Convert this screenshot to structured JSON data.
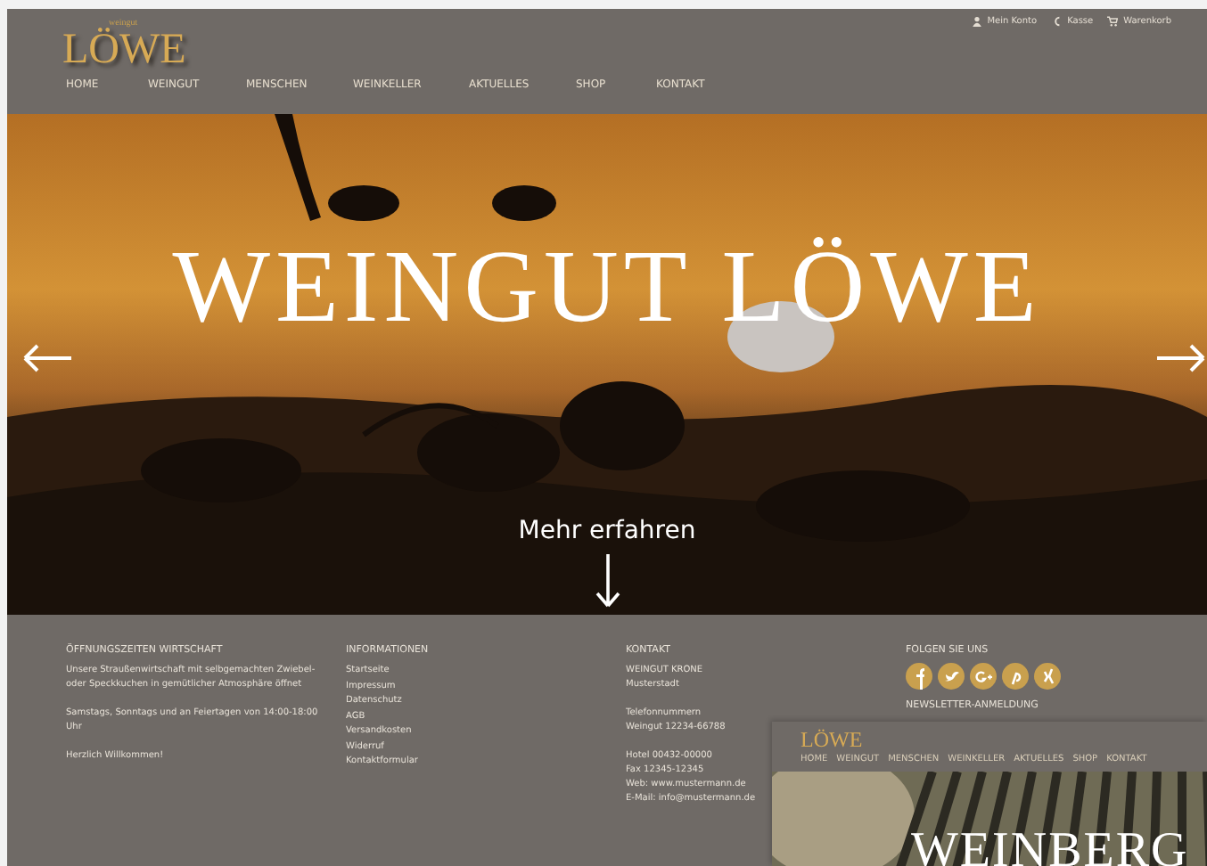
{
  "account_links": [
    {
      "kind": "account",
      "label": "Mein Konto"
    },
    {
      "kind": "checkout",
      "label": "Kasse"
    },
    {
      "kind": "basket",
      "label": "Warenkorb"
    }
  ],
  "logo": {
    "small": "weingut",
    "name": "LÖWE"
  },
  "nav": [
    "HOME",
    "WEINGUT",
    "MENSCHEN",
    "WEINKELLER",
    "AKTUELLES",
    "SHOP",
    "KONTAKT"
  ],
  "hero": {
    "title": "WEINGUT LÖWE",
    "button": "Mehr erfahren"
  },
  "footer": [
    {
      "heading": "ÖFFNUNGSZEITEN WIRTSCHAFT",
      "kind": "text",
      "lines": [
        "Unsere Straußenwirtschaft mit selbgemachten Zwiebel- oder Speckkuchen in gemütlicher Atmosphäre öffnet",
        "Samstags, Sonntags und an Feiertagen von 14:00-18:00 Uhr",
        "Herzlich Willkommen!"
      ]
    },
    {
      "heading": "INFORMATIONEN",
      "kind": "links",
      "lines": [
        "Startseite",
        "Impressum",
        "Datenschutz",
        "AGB",
        "Versandkosten",
        "Widerruf",
        "Kontaktformular"
      ]
    },
    {
      "heading": "KONTAKT",
      "kind": "text",
      "lines": [
        "WEINGUT KRONE\nMusterstadt",
        "Telefonnummern\nWeingut 12234-66788",
        "Hotel 00432-00000\nFax 12345-12345\nWeb: www.mustermann.de\nE-Mail: info@mustermann.de"
      ]
    },
    {
      "heading": "FOLGEN SIE UNS",
      "kind": "social",
      "social": [
        {
          "kind": "facebook"
        },
        {
          "kind": "twitter"
        },
        {
          "kind": "google"
        },
        {
          "kind": "pinterest"
        },
        {
          "kind": "xing"
        }
      ],
      "sub_heading": "NEWSLETTER-ANMELDUNG"
    }
  ],
  "inset": {
    "logo": "LÖWE",
    "nav": [
      "HOME",
      "WEINGUT",
      "MENSCHEN",
      "WEINKELLER",
      "AKTUELLES",
      "SHOP",
      "KONTAKT"
    ],
    "title": "WEINBERG"
  }
}
